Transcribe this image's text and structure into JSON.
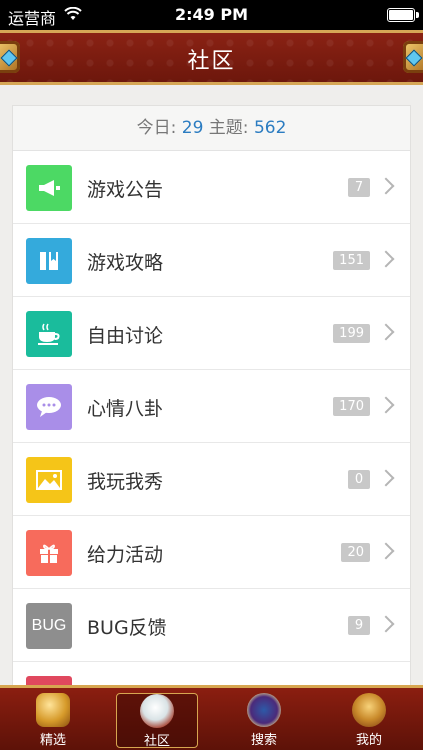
{
  "status_bar": {
    "carrier": "运营商",
    "time": "2:49 PM"
  },
  "header": {
    "title": "社区"
  },
  "summary": {
    "today_label": "今日:",
    "today_count": "29",
    "topics_label": "主题:",
    "topics_count": "562"
  },
  "forums": [
    {
      "label": "游戏公告",
      "count": "7",
      "icon": "megaphone-icon",
      "color": "#4cd964"
    },
    {
      "label": "游戏攻略",
      "count": "151",
      "icon": "book-icon",
      "color": "#34aadc"
    },
    {
      "label": "自由讨论",
      "count": "199",
      "icon": "coffee-cup-icon",
      "color": "#1abc9c"
    },
    {
      "label": "心情八卦",
      "count": "170",
      "icon": "chat-bubble-icon",
      "color": "#a98ee8"
    },
    {
      "label": "我玩我秀",
      "count": "0",
      "icon": "picture-icon",
      "color": "#f5c518"
    },
    {
      "label": "给力活动",
      "count": "20",
      "icon": "gift-icon",
      "color": "#f76b5c"
    },
    {
      "label": "BUG反馈",
      "count": "9",
      "icon": "bug-icon",
      "icon_text": "BUG",
      "color": "#8e8e8e"
    }
  ],
  "partial_row_color": "#e0485e",
  "tabs": [
    {
      "label": "精选",
      "icon": "treasure-chest-icon",
      "active": false
    },
    {
      "label": "社区",
      "icon": "wing-crest-icon",
      "active": true
    },
    {
      "label": "搜索",
      "icon": "sword-emblem-icon",
      "active": false
    },
    {
      "label": "我的",
      "icon": "warrior-helmet-icon",
      "active": false
    }
  ]
}
